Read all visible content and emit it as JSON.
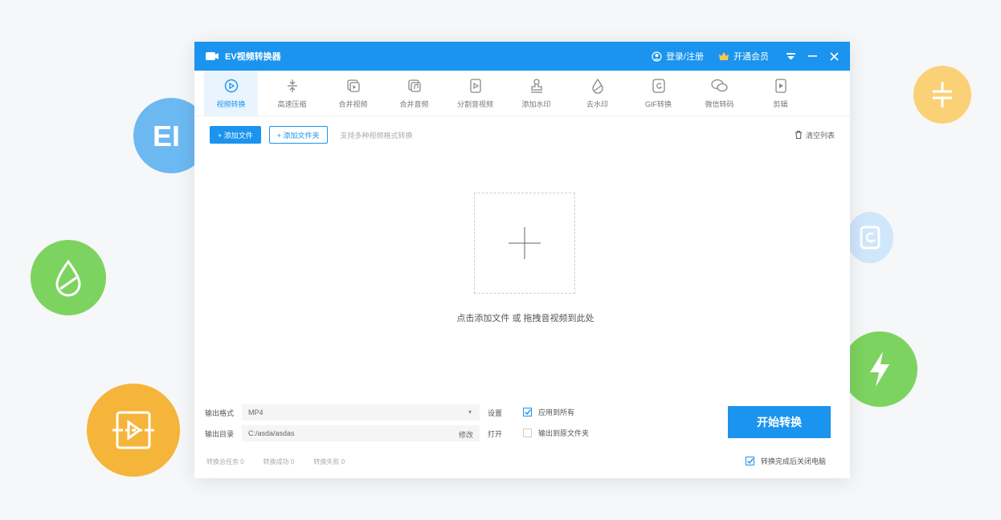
{
  "app": {
    "title": "EV视频转换器"
  },
  "titlebar": {
    "login": "登录/注册",
    "vip": "开通会员"
  },
  "tools": [
    {
      "label": "视频转换",
      "icon": "video-convert-icon"
    },
    {
      "label": "高速压缩",
      "icon": "compress-icon"
    },
    {
      "label": "合并视频",
      "icon": "merge-video-icon"
    },
    {
      "label": "合并音频",
      "icon": "merge-audio-icon"
    },
    {
      "label": "分割音视频",
      "icon": "split-icon"
    },
    {
      "label": "添加水印",
      "icon": "watermark-icon"
    },
    {
      "label": "去水印",
      "icon": "remove-watermark-icon"
    },
    {
      "label": "GIF转换",
      "icon": "gif-icon"
    },
    {
      "label": "微信转码",
      "icon": "wechat-icon"
    },
    {
      "label": "剪辑",
      "icon": "edit-icon"
    }
  ],
  "actions": {
    "add_file": "+ 添加文件",
    "add_folder": "+ 添加文件夹",
    "hint": "支持多种视频格式转换",
    "clear_list": "清空列表"
  },
  "dropzone": {
    "text": "点击添加文件 或 拖拽音视频到此处"
  },
  "output": {
    "format_label": "输出格式",
    "format_value": "MP4",
    "settings": "设置",
    "dir_label": "输出目录",
    "dir_value": "C:/asda/asdas",
    "change": "修改",
    "open": "打开"
  },
  "options": {
    "apply_all": "应用到所有",
    "source_folder": "输出到原文件夹",
    "shutdown": "转换完成后关闭电脑"
  },
  "stats": [
    "转换总任务 0",
    "转换成功 0",
    "转换失败 0"
  ],
  "start_button": "开始转换",
  "colors": {
    "accent": "#1a94ee",
    "orange": "#f5b53a",
    "green": "#7dd35f",
    "blue": "#6cb9f2"
  }
}
